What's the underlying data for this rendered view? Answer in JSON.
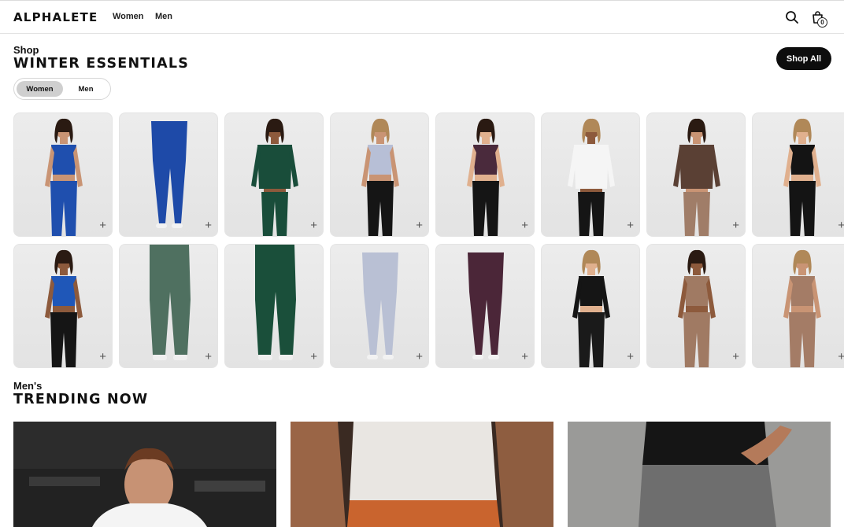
{
  "header": {
    "logo": "ALPHALETE",
    "nav": [
      "Women",
      "Men"
    ],
    "cart_count": "0",
    "icons": [
      "search-icon",
      "bag-icon"
    ]
  },
  "winter": {
    "eyebrow": "Shop",
    "title": "WINTER ESSENTIALS",
    "shop_all": "Shop All",
    "toggle": [
      "Women",
      "Men"
    ],
    "toggle_selected": "Women",
    "add_symbol": "+"
  },
  "products": [
    {
      "top": "#1f4fae",
      "bottom": "#1f4fae",
      "kind": "set"
    },
    {
      "top": "#1e4aa8",
      "bottom": "#1e4aa8",
      "kind": "legs"
    },
    {
      "top": "#194d3a",
      "bottom": "#194d3a",
      "kind": "jacket"
    },
    {
      "top": "#b7bfd6",
      "bottom": "#151515",
      "kind": "set"
    },
    {
      "top": "#4a2a3c",
      "bottom": "#151515",
      "kind": "set"
    },
    {
      "top": "#f5f5f5",
      "bottom": "#151515",
      "kind": "hoodie"
    },
    {
      "top": "#5a4034",
      "bottom": "#a07d68",
      "kind": "hoodie"
    },
    {
      "top": "#141414",
      "bottom": "#141414",
      "kind": "set"
    },
    {
      "top": "#1f57b8",
      "bottom": "#151515",
      "kind": "set"
    },
    {
      "top": "#4f7060",
      "bottom": "#4f7060",
      "kind": "pants"
    },
    {
      "top": "#1a4f3a",
      "bottom": "#1a4f3a",
      "kind": "pants"
    },
    {
      "top": "#b9c0d4",
      "bottom": "#b9c0d4",
      "kind": "legs"
    },
    {
      "top": "#4b2638",
      "bottom": "#4b2638",
      "kind": "legs"
    },
    {
      "top": "#151515",
      "bottom": "#1a1a1a",
      "kind": "back"
    },
    {
      "top": "#a07a63",
      "bottom": "#a07a63",
      "kind": "set"
    },
    {
      "top": "#a47c66",
      "bottom": "#a47c66",
      "kind": "set"
    }
  ],
  "trending": {
    "eyebrow": "Men's",
    "title": "TRENDING NOW"
  },
  "colors": {
    "accent": "#0d0d0d",
    "card_bg": "#e6e6e6",
    "toggle_active": "#cfcfcf"
  }
}
